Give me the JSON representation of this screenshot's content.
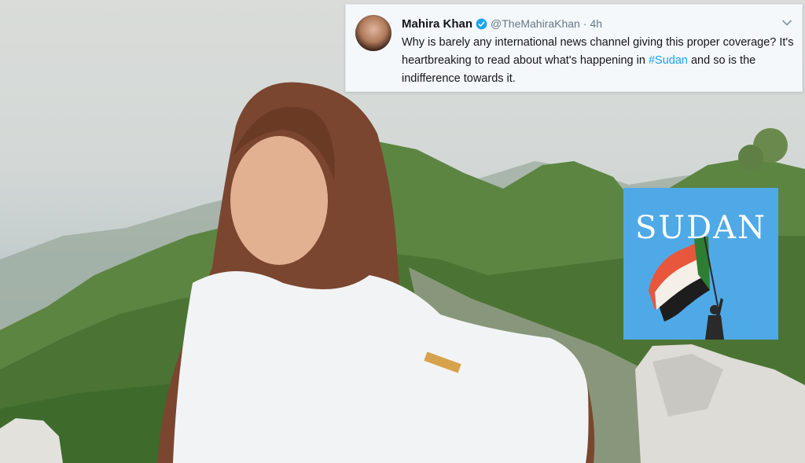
{
  "tweet": {
    "name": "Mahira Khan",
    "handle": "@TheMahiraKhan",
    "separator": "·",
    "time": "4h",
    "text_before": "Why is barely any international news channel giving this proper coverage? It's heartbreaking to read about what's happening in ",
    "hashtag": "#Sudan",
    "text_after": " and so is the indifference towards it.",
    "link_color": "#1da1f2",
    "verified_color": "#1da1f2"
  },
  "sudan_card": {
    "title": "SUDAN",
    "background": "#4fa9e6"
  }
}
